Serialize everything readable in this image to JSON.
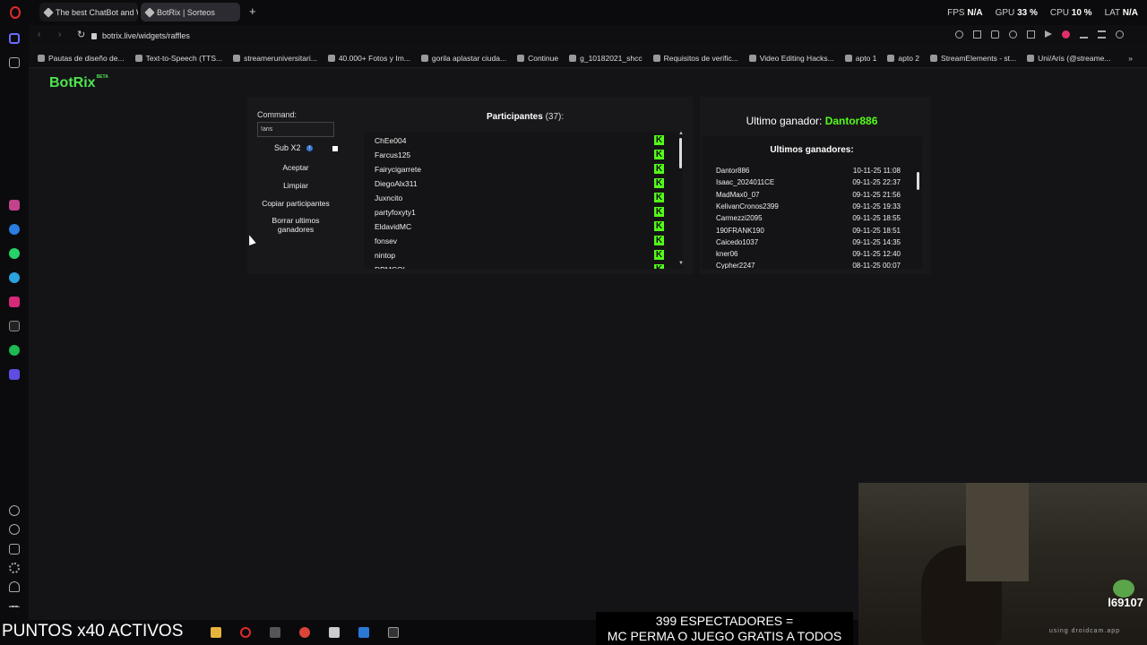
{
  "browser": {
    "tabs": [
      {
        "title": "The best ChatBot and Wi"
      },
      {
        "title": "BotRix | Sorteos"
      }
    ],
    "new_tab_symbol": "+",
    "url": "botrix.live/widgets/raffles",
    "stats": {
      "fps_label": "FPS",
      "fps": "N/A",
      "gpu_label": "GPU",
      "gpu": "33 %",
      "cpu_label": "CPU",
      "cpu": "10 %",
      "lat_label": "LAT",
      "lat": "N/A"
    }
  },
  "bookmarks": [
    "Pautas de diseño de...",
    "Text-to-Speech (TTS...",
    "streameruniversitari...",
    "40.000+ Fotos y Im...",
    "gorila aplastar ciuda...",
    "Continue",
    "g_10182021_shcc",
    "Requisitos de verific...",
    "Video Editing Hacks...",
    "apto 1",
    "apto 2",
    "StreamElements - st...",
    "Uni/Aris (@streame..."
  ],
  "brand": {
    "name": "BotRix",
    "badge": "BETA"
  },
  "raffle": {
    "command_label": "Command:",
    "command_value": "!aris",
    "sub_label": "Sub X2",
    "accept": "Aceptar",
    "clear": "Limpiar",
    "copy_participants": "Copiar participantes",
    "delete_winners": "Borrar ultimos ganadores",
    "participants_title": "Participantes",
    "participants_count": "(37):",
    "participants": [
      "ChEe004",
      "Farcus125",
      "Fairycigarrete",
      "DiegoAlx311",
      "Juxncito",
      "partyfoxyty1",
      "EldavidMC",
      "fonsev",
      "nintop",
      "DPMCOL"
    ]
  },
  "winners": {
    "last_label": "Ultimo ganador:",
    "last_name": "Dantor886",
    "title": "Ultimos ganadores:",
    "list": [
      {
        "name": "Dantor886",
        "date": "10-11-25 11:08"
      },
      {
        "name": "Isaac_2024011CE",
        "date": "09-11-25 22:37"
      },
      {
        "name": "MadMax0_07",
        "date": "09-11-25 21:56"
      },
      {
        "name": "KelivanCronos2399",
        "date": "09-11-25 19:33"
      },
      {
        "name": "Carmezzi2095",
        "date": "09-11-25 18:55"
      },
      {
        "name": "190FRANK190",
        "date": "09-11-25 18:51"
      },
      {
        "name": "Caicedo1037",
        "date": "09-11-25 14:35"
      },
      {
        "name": "kner06",
        "date": "09-11-25 12:40"
      },
      {
        "name": "Cypher2247",
        "date": "08-11-25 00:07"
      }
    ]
  },
  "overlay": {
    "ticker": "PUNTOS x40 ACTIVOS",
    "spectators_line1": "399 ESPECTADORES =",
    "spectators_line2": "MC PERMA O JUEGO GRATIS A TODOS",
    "cam_name": "l69107",
    "cam_watermark": "using droidcam.app"
  },
  "colors": {
    "accent": "#53fc18",
    "brand": "#4ee44e"
  }
}
